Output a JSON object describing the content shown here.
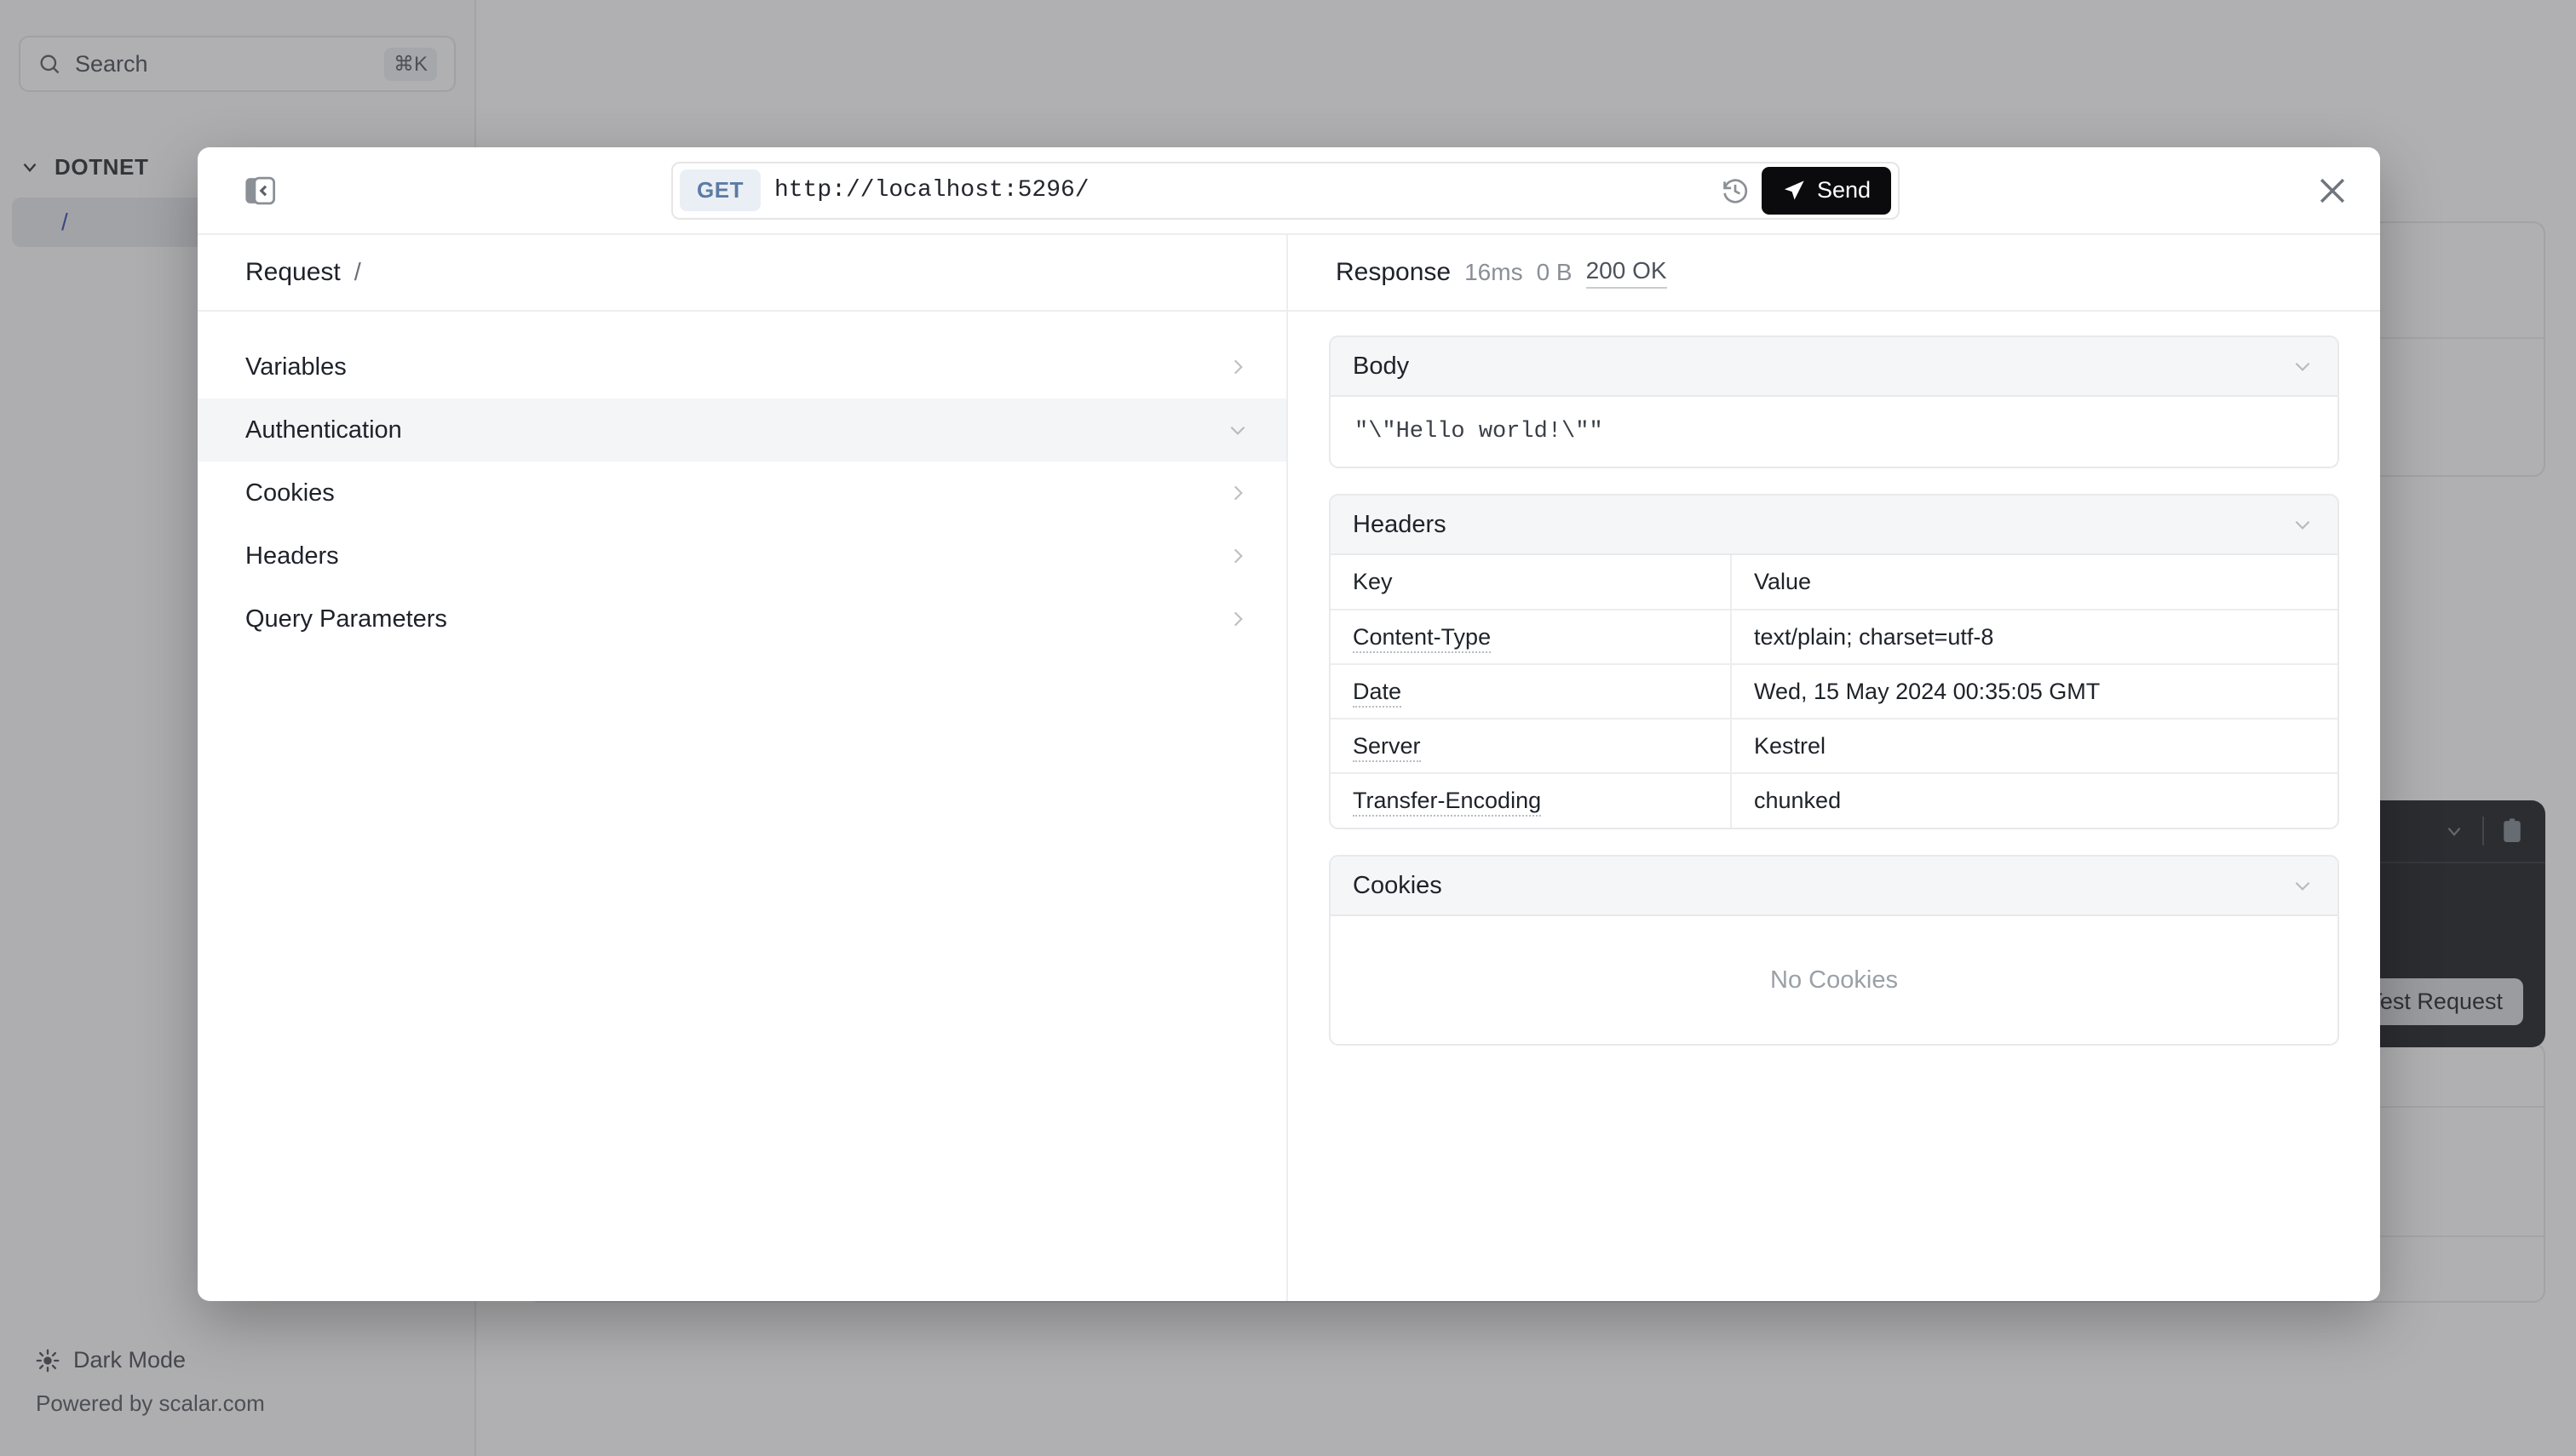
{
  "background": {
    "sidebar": {
      "search": {
        "placeholder": "Search",
        "shortcut": "⌘K",
        "icon": "search-icon"
      },
      "section": {
        "label": "DOTNET",
        "icon": "chevron-down-icon"
      },
      "items": [
        {
          "label": "/",
          "active": true
        }
      ],
      "footer": {
        "dark_mode_label": "Dark Mode",
        "dark_mode_icon": "sun-icon",
        "powered_by": "Powered by scalar.com"
      }
    },
    "code_block": {
      "copy_icon": "clipboard-icon",
      "dropdown_icon": "chevron-down-icon",
      "button_label": "Test Request"
    }
  },
  "modal": {
    "panel_toggle_icon": "sidebar-collapse-icon",
    "close_icon": "close-icon",
    "address_bar": {
      "method": "GET",
      "url": "http://localhost:5296/",
      "history_icon": "history-icon",
      "send_label": "Send",
      "send_icon": "paper-plane-icon"
    },
    "request": {
      "title": "Request",
      "path": "/",
      "sections": [
        {
          "label": "Variables",
          "expanded": false,
          "icon": "chevron-right-icon"
        },
        {
          "label": "Authentication",
          "expanded": true,
          "icon": "chevron-down-icon"
        },
        {
          "label": "Cookies",
          "expanded": false,
          "icon": "chevron-right-icon"
        },
        {
          "label": "Headers",
          "expanded": false,
          "icon": "chevron-right-icon"
        },
        {
          "label": "Query Parameters",
          "expanded": false,
          "icon": "chevron-right-icon"
        }
      ]
    },
    "response": {
      "title": "Response",
      "duration": "16ms",
      "size": "0 B",
      "status": "200 OK",
      "body": {
        "title": "Body",
        "icon": "chevron-down-icon",
        "content": "\"\\\"Hello world!\\\"\""
      },
      "headers": {
        "title": "Headers",
        "icon": "chevron-down-icon",
        "columns": [
          "Key",
          "Value"
        ],
        "rows": [
          {
            "key": "Content-Type",
            "value": "text/plain; charset=utf-8"
          },
          {
            "key": "Date",
            "value": "Wed, 15 May 2024 00:35:05 GMT"
          },
          {
            "key": "Server",
            "value": "Kestrel"
          },
          {
            "key": "Transfer-Encoding",
            "value": "chunked"
          }
        ]
      },
      "cookies": {
        "title": "Cookies",
        "icon": "chevron-down-icon",
        "empty_label": "No Cookies"
      }
    }
  }
}
